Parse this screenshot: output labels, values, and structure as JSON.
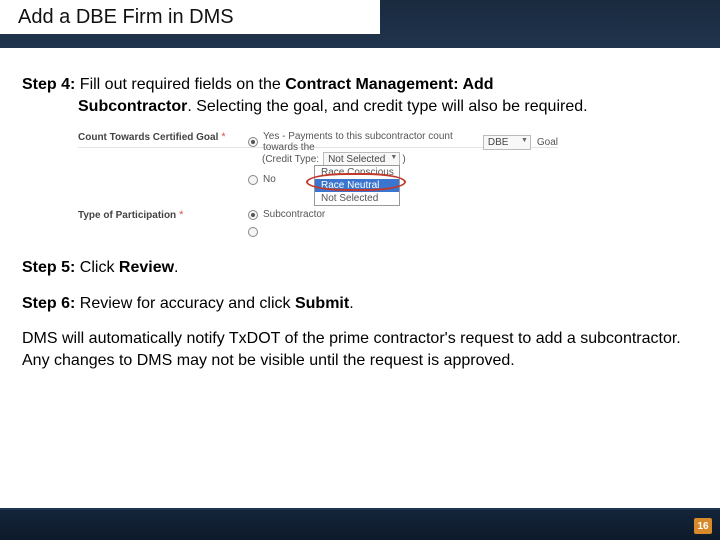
{
  "header": {
    "title": "Add a DBE Firm in DMS"
  },
  "step4": {
    "lead": "Step 4:",
    "t1": " Fill out required fields on the ",
    "b1": "Contract Management: Add",
    "b2": "Subcontractor",
    "t2": ". Selecting the goal, and credit type will also be required."
  },
  "shot": {
    "count_label": "Count Towards Certified Goal",
    "yes_label": "Yes - Payments to this subcontractor count towards the",
    "goal_select": "DBE",
    "goal_word": "Goal",
    "credit_label": "(Credit Type:",
    "credit_select": "Not Selected",
    "close_paren": ")",
    "no_label": "No",
    "type_label": "Type of Participation",
    "sub_label": "Subcontractor",
    "opts": {
      "a": "Race Conscious",
      "b": "Race Neutral",
      "c": "Not Selected"
    }
  },
  "step5": {
    "lead": "Step 5:",
    "t1": " Click ",
    "b1": "Review",
    "t2": "."
  },
  "step6": {
    "lead": "Step 6:",
    "t1": " Review for accuracy and click ",
    "b1": "Submit",
    "t2": "."
  },
  "note": "DMS will automatically notify TxDOT of the prime contractor's request to add a subcontractor. Any changes to DMS may not be visible until the request is approved.",
  "page": "16"
}
